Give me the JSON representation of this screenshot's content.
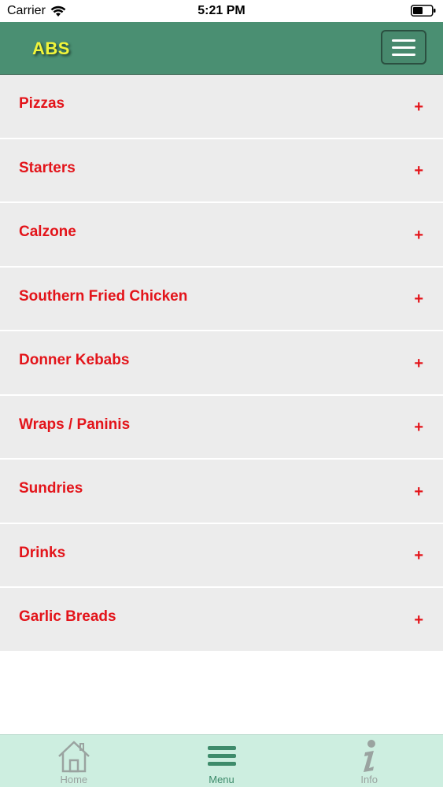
{
  "status_bar": {
    "carrier": "Carrier",
    "time": "5:21 PM"
  },
  "header": {
    "brand": "ABS"
  },
  "categories": [
    {
      "label": "Pizzas",
      "expand": "+"
    },
    {
      "label": "Starters",
      "expand": "+"
    },
    {
      "label": "Calzone",
      "expand": "+"
    },
    {
      "label": "Southern Fried Chicken",
      "expand": "+"
    },
    {
      "label": "Donner Kebabs",
      "expand": "+"
    },
    {
      "label": "Wraps / Paninis",
      "expand": "+"
    },
    {
      "label": "Sundries",
      "expand": "+"
    },
    {
      "label": "Drinks",
      "expand": "+"
    },
    {
      "label": "Garlic Breads",
      "expand": "+"
    }
  ],
  "tab_bar": {
    "tabs": [
      {
        "label": "Home",
        "icon": "home-icon"
      },
      {
        "label": "Menu",
        "icon": "menu-icon",
        "active": true
      },
      {
        "label": "Info",
        "icon": "info-icon"
      }
    ]
  },
  "colors": {
    "header_bg": "#4a8f72",
    "brand": "#f2f53a",
    "category_text": "#e3141a",
    "category_bg": "#ececec",
    "tab_bar_bg": "#cdeee0",
    "tab_active": "#3e8b6b",
    "tab_inactive": "#9aa3a0"
  }
}
